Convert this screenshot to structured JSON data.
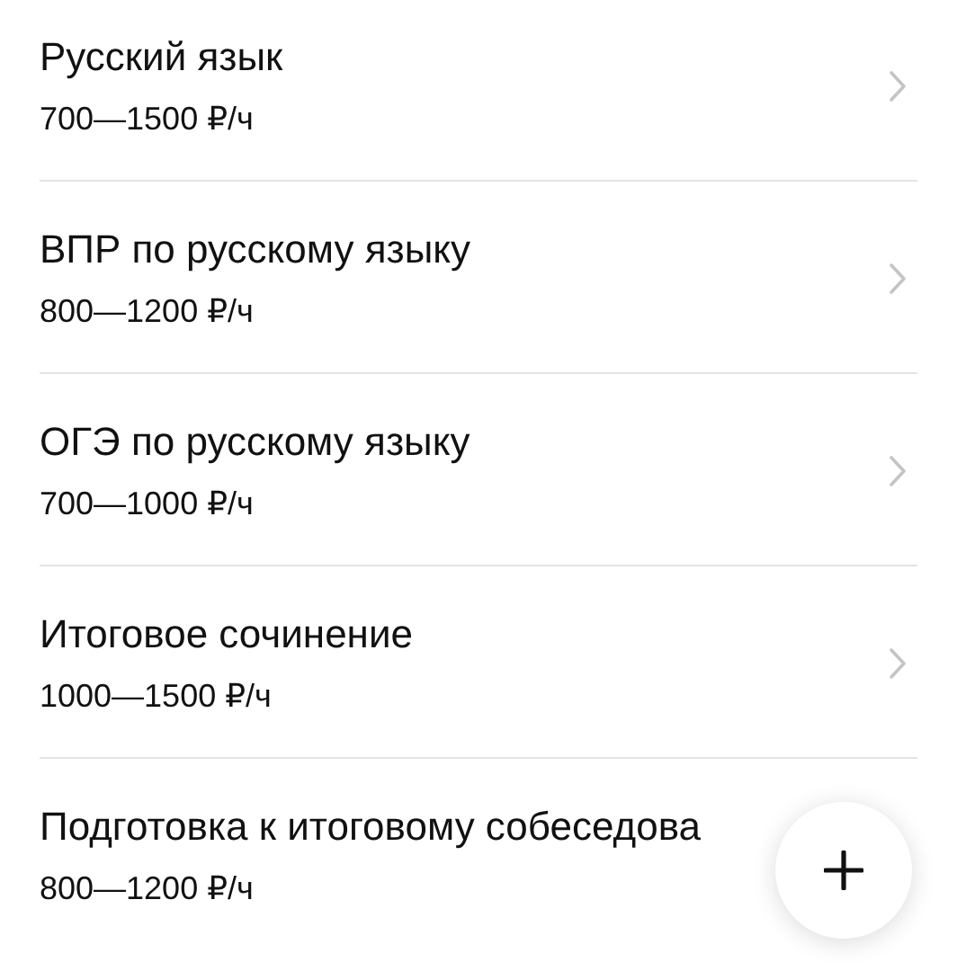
{
  "subjects": [
    {
      "title": "Русский язык",
      "price": "700—1500 ₽/ч"
    },
    {
      "title": "ВПР по русскому языку",
      "price": "800—1200 ₽/ч"
    },
    {
      "title": "ОГЭ по русскому языку",
      "price": "700—1000 ₽/ч"
    },
    {
      "title": "Итоговое сочинение",
      "price": "1000—1500 ₽/ч"
    },
    {
      "title": "Подготовка к итоговому собеседова",
      "price": "800—1200 ₽/ч"
    }
  ],
  "add_button": {
    "visible": true
  }
}
